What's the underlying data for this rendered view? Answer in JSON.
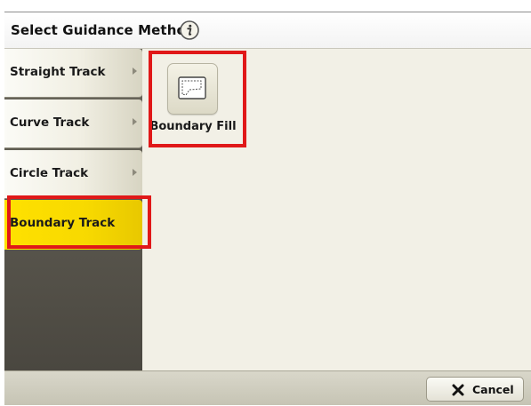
{
  "header": {
    "title": "Select Guidance Method",
    "info_icon": "info-icon"
  },
  "sidebar": {
    "items": [
      {
        "label": "Straight Track",
        "has_submenu": true,
        "selected": false
      },
      {
        "label": "Curve Track",
        "has_submenu": true,
        "selected": false
      },
      {
        "label": "Circle Track",
        "has_submenu": true,
        "selected": false
      },
      {
        "label": "Boundary Track",
        "has_submenu": false,
        "selected": true
      }
    ]
  },
  "options": [
    {
      "label": "Boundary Fill",
      "icon": "boundary-fill-icon"
    }
  ],
  "footer": {
    "cancel_label": "Cancel",
    "cancel_icon": "close-x-icon"
  },
  "colors": {
    "highlight_outline": "#e01818",
    "selected_item": "#ffe100",
    "panel_bg": "#f2f0e6"
  }
}
